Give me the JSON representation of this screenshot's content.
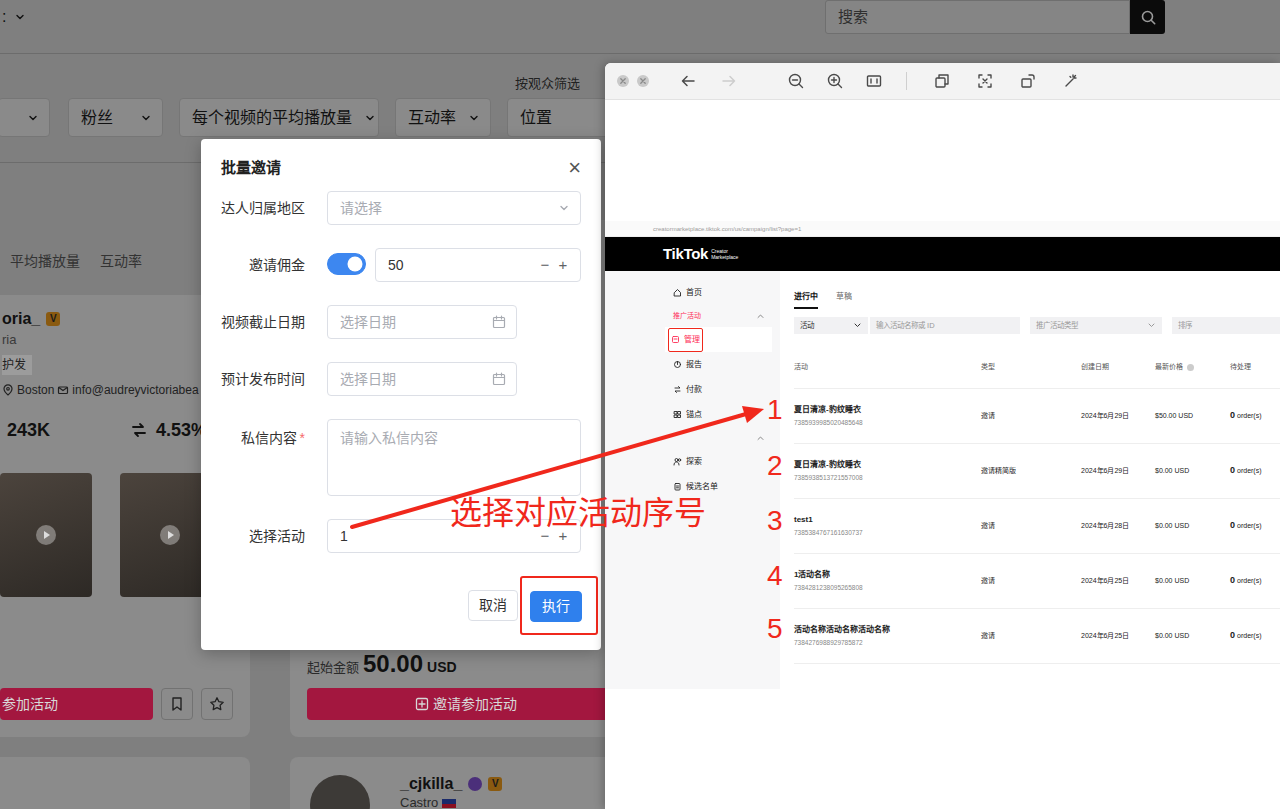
{
  "background": {
    "sort_label": ":",
    "search": {
      "placeholder": "搜索"
    },
    "audience_filter_label": "按观众筛选",
    "filters": [
      "",
      "粉丝",
      "每个视频的平均播放量",
      "互动率",
      "位置"
    ],
    "tabs": [
      "平均播放量",
      "互动率"
    ],
    "creator": {
      "name": "oria_",
      "badge": "V",
      "subtitle": "ria",
      "tag": "护发",
      "city": "Boston",
      "email": "info@audreyvictoriabea",
      "followers": "243K",
      "engagement": "4.53%",
      "invite_button": "参加活动"
    },
    "offer": {
      "price_label": "起始金额",
      "price": "50.00",
      "currency": "USD",
      "invite_button": "邀请参加活动"
    },
    "next_creator": {
      "name": "_cjkilla_",
      "badge": "V",
      "location": "Castro"
    }
  },
  "dialog": {
    "title": "批量邀请",
    "close": "×",
    "fields": [
      {
        "kind": "select",
        "label": "达人归属地区",
        "placeholder": "请选择",
        "required": false
      },
      {
        "kind": "switch_number",
        "label": "邀请佣金",
        "on": true,
        "value": "50",
        "minus": "−",
        "plus": "+",
        "required": false
      },
      {
        "kind": "date",
        "label": "视频截止日期",
        "placeholder": "选择日期",
        "required": false
      },
      {
        "kind": "date",
        "label": "预计发布时间",
        "placeholder": "选择日期",
        "required": false
      },
      {
        "kind": "textarea",
        "label": "私信内容",
        "placeholder": "请输入私信内容",
        "required": true,
        "required_mark": "*"
      },
      {
        "kind": "number",
        "label": "选择活动",
        "value": "1",
        "minus": "−",
        "plus": "+",
        "required": false
      }
    ],
    "buttons": [
      {
        "label": "取消",
        "primary": false,
        "highlighted": false
      },
      {
        "label": "执行",
        "primary": true,
        "highlighted": true
      }
    ]
  },
  "viewer": {
    "toolbar": {
      "back_disabled": false,
      "forward_disabled": true
    },
    "screenshot": {
      "url": "creatormarketplace.tiktok.com/us/campaign/list?page=1",
      "brand": "TikTok",
      "brand_sub": [
        "Creator",
        "Marketplace"
      ],
      "sidebar": [
        {
          "kind": "item",
          "label": "首页",
          "selected": false,
          "highlighted": false
        },
        {
          "kind": "section",
          "label": "推广活动",
          "expanded": true
        },
        {
          "kind": "item",
          "label": "管理",
          "selected": true,
          "highlighted": true
        },
        {
          "kind": "item",
          "label": "报告",
          "selected": false,
          "highlighted": false
        },
        {
          "kind": "item",
          "label": "付款",
          "selected": false,
          "highlighted": false
        },
        {
          "kind": "item",
          "label": "锚点",
          "selected": false,
          "highlighted": false
        },
        {
          "kind": "section",
          "label": "",
          "expanded": true
        },
        {
          "kind": "item",
          "label": "探索",
          "selected": false,
          "highlighted": false
        },
        {
          "kind": "item",
          "label": "候选名单",
          "selected": false,
          "highlighted": false
        }
      ],
      "tabs": [
        {
          "label": "进行中",
          "selected": true
        },
        {
          "label": "草稿",
          "selected": false
        }
      ],
      "filters": {
        "type_select": "活动",
        "search_placeholder": "输入活动名称或 ID",
        "campaign_type": "推广活动类型",
        "sort": "排序"
      },
      "table": {
        "columns": [
          "活动",
          "类型",
          "创建日期",
          "最新价格",
          "待处理"
        ],
        "rows": [
          {
            "name": "夏日清凉-豹纹睡衣",
            "id": "7385939985020485648",
            "type": "邀请",
            "date": "2024年6月29日",
            "price": "$50.00 USD",
            "pending": "0",
            "pending_unit": "order(s)"
          },
          {
            "name": "夏日清凉-豹纹睡衣",
            "id": "7385938513721557008",
            "type": "邀请精简版",
            "date": "2024年6月29日",
            "price": "$0.00 USD",
            "pending": "0",
            "pending_unit": "order(s)"
          },
          {
            "name": "test1",
            "id": "7385384767161630737",
            "type": "邀请",
            "date": "2024年6月28日",
            "price": "$0.00 USD",
            "pending": "0",
            "pending_unit": "order(s)"
          },
          {
            "name": "1活动名称",
            "id": "7384281238095265808",
            "type": "邀请",
            "date": "2024年6月25日",
            "price": "$0.00 USD",
            "pending": "0",
            "pending_unit": "order(s)"
          },
          {
            "name": "活动名称活动名称活动名称",
            "id": "7384276988929785872",
            "type": "邀请",
            "date": "2024年6月25日",
            "price": "$0.00 USD",
            "pending": "0",
            "pending_unit": "order(s)"
          }
        ]
      }
    }
  },
  "annotation": {
    "numbers": [
      "1",
      "2",
      "3",
      "4",
      "5"
    ],
    "instruction": "选择对应活动序号"
  }
}
